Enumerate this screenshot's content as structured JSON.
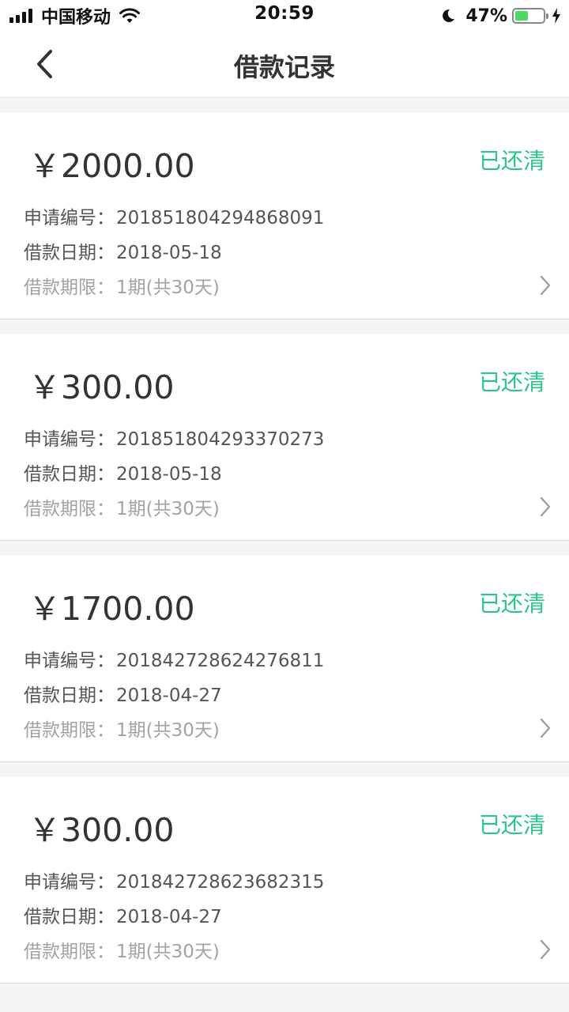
{
  "status_bar": {
    "carrier": "中国移动",
    "time": "20:59",
    "battery_percent": "47%",
    "battery_level": 0.47,
    "icons": [
      "signal-icon",
      "wifi-icon",
      "moon-icon",
      "battery-icon",
      "charging-icon"
    ]
  },
  "nav": {
    "title": "借款记录",
    "back_icon": "chevron-left-icon"
  },
  "colors": {
    "accent_green": "#2bc48a",
    "text_primary": "#333333",
    "text_muted": "#a3a3a3",
    "background": "#f5f5f5"
  },
  "records": [
    {
      "amount": "￥2000.00",
      "status": "已还清",
      "app_no_label": "申请编号：",
      "app_no": "201851804294868091",
      "date_label": "借款日期：",
      "date": "2018-05-18",
      "term_label": "借款期限：",
      "term": "1期(共30天)"
    },
    {
      "amount": "￥300.00",
      "status": "已还清",
      "app_no_label": "申请编号：",
      "app_no": "201851804293370273",
      "date_label": "借款日期：",
      "date": "2018-05-18",
      "term_label": "借款期限：",
      "term": "1期(共30天)"
    },
    {
      "amount": "￥1700.00",
      "status": "已还清",
      "app_no_label": "申请编号：",
      "app_no": "201842728624276811",
      "date_label": "借款日期：",
      "date": "2018-04-27",
      "term_label": "借款期限：",
      "term": "1期(共30天)"
    },
    {
      "amount": "￥300.00",
      "status": "已还清",
      "app_no_label": "申请编号：",
      "app_no": "201842728623682315",
      "date_label": "借款日期：",
      "date": "2018-04-27",
      "term_label": "借款期限：",
      "term": "1期(共30天)"
    }
  ]
}
